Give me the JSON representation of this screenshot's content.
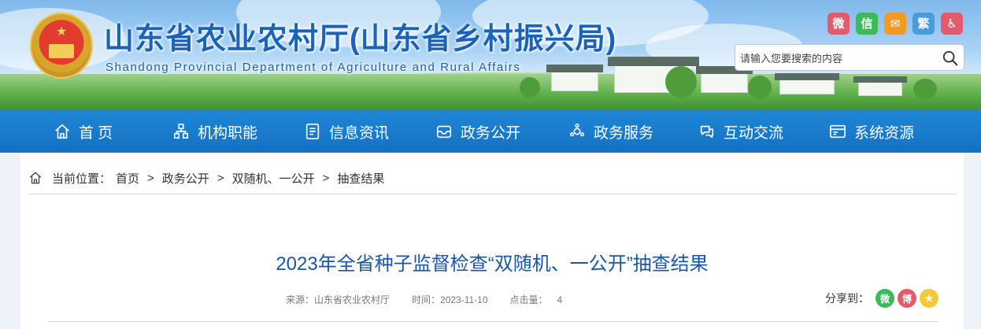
{
  "header": {
    "title": "山东省农业农村厅(山东省乡村振兴局)",
    "subtitle": "Shandong Provincial Department of Agriculture and Rural Affairs",
    "social": [
      {
        "name": "weibo-icon",
        "glyph": "微",
        "color": "#e35b6b"
      },
      {
        "name": "wechat-icon",
        "glyph": "信",
        "color": "#3dba58"
      },
      {
        "name": "mail-icon",
        "glyph": "✉",
        "color": "#f29a24"
      },
      {
        "name": "traditional-chinese-icon",
        "glyph": "繁",
        "color": "#4a9bd9"
      },
      {
        "name": "accessibility-icon",
        "glyph": "♿",
        "color": "#e35b6b"
      }
    ],
    "search": {
      "placeholder": "请输入您要搜索的内容",
      "icon": "search-icon"
    }
  },
  "nav": {
    "items": [
      {
        "label": "首 页",
        "icon": "home-icon"
      },
      {
        "label": "机构职能",
        "icon": "org-structure-icon"
      },
      {
        "label": "信息资讯",
        "icon": "document-icon"
      },
      {
        "label": "政务公开",
        "icon": "inbox-icon"
      },
      {
        "label": "政务服务",
        "icon": "service-icon"
      },
      {
        "label": "互动交流",
        "icon": "chat-icon"
      },
      {
        "label": "系统资源",
        "icon": "browser-window-icon"
      }
    ]
  },
  "breadcrumb": {
    "label": "当前位置：",
    "items": [
      "首页",
      "政务公开",
      "双随机、一公开",
      "抽查结果"
    ],
    "separator": ">"
  },
  "article": {
    "title": "2023年全省种子监督检查“双随机、一公开”抽查结果",
    "source": "来源：山东省农业农村厅",
    "date": "时间：2023-11-10",
    "hits_label": "点击量：",
    "hits": "4"
  },
  "share": {
    "label": "分享到：",
    "targets": [
      {
        "name": "share-wechat-icon",
        "glyph": "微",
        "color": "#3dba58"
      },
      {
        "name": "share-weibo-icon",
        "glyph": "博",
        "color": "#e35b6b"
      },
      {
        "name": "share-favorite-icon",
        "glyph": "★",
        "color": "#f3c83a"
      }
    ]
  },
  "colors": {
    "nav_bg": "#1a7ccf",
    "title_blue": "#1a56a5",
    "brand_blue": "#1a63b8"
  }
}
